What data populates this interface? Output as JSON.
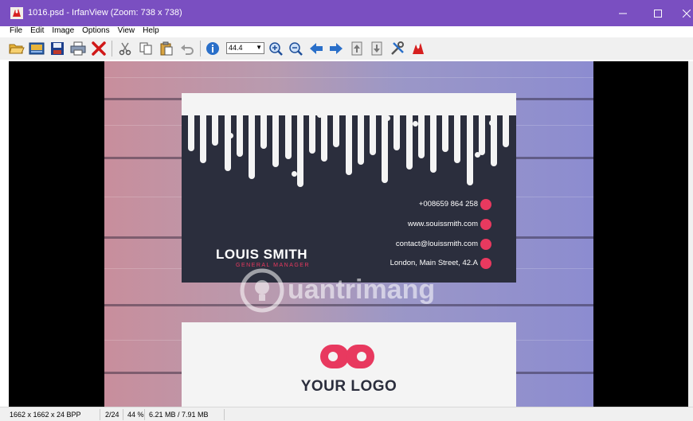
{
  "window": {
    "title": "1016.psd - IrfanView (Zoom: 738 x 738)",
    "accent_color": "#7a4fc1"
  },
  "menu": [
    "File",
    "Edit",
    "Image",
    "Options",
    "View",
    "Help"
  ],
  "toolbar": {
    "icons": [
      "open-icon",
      "slideshow-icon",
      "save-icon",
      "print-icon",
      "delete-icon",
      "cut-icon",
      "copy-icon",
      "paste-icon",
      "undo-icon",
      "info-icon",
      "zoom-in-icon",
      "zoom-out-icon",
      "previous-icon",
      "next-icon",
      "first-page-icon",
      "last-page-icon",
      "settings-icon",
      "irfanview-logo-icon"
    ],
    "zoom_value": "44.4"
  },
  "image": {
    "card_front": {
      "name": "LOUIS SMITH",
      "role": "GENERAL MANAGER",
      "contacts": [
        {
          "text": "+008659 864 258",
          "icon": "globe-icon"
        },
        {
          "text": "www.souissmith.com",
          "icon": "phone-icon"
        },
        {
          "text": "contact@louissmith.com",
          "icon": "mail-icon"
        },
        {
          "text": "London, Main Street, 42.A",
          "icon": "location-icon"
        }
      ],
      "dark_color": "#2b2e3d",
      "accent_color": "#e8395f"
    },
    "card_back": {
      "logo_text": "YOUR LOGO"
    },
    "watermark": "uantrimang"
  },
  "status": {
    "dimensions": "1662 x 1662 x 24 BPP",
    "page": "2/24",
    "zoom": "44 %",
    "memory": "6.21 MB / 7.91 MB"
  }
}
